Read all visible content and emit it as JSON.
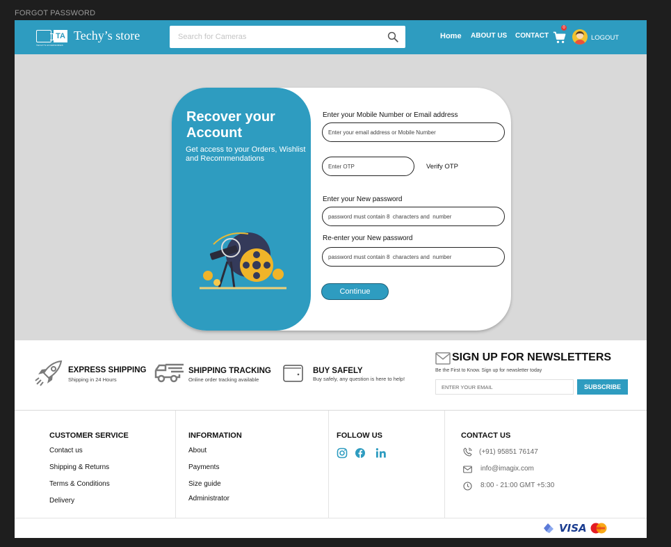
{
  "frame_label": "FORGOT PASSWORD",
  "header": {
    "store_name": "Techy’s store",
    "logo_text": "TA",
    "logo_sub": "TECHY'S ACCESSORIES",
    "search_placeholder": "Search for Cameras",
    "nav": [
      "Home",
      "ABOUT US",
      "CONTACT"
    ],
    "cart_count": "0",
    "logout": "LOGOUT"
  },
  "recover": {
    "title": "Recover your Account",
    "subtitle": "Get access to your Orders, Wishlist and Recommendations",
    "mobile_label": "Enter your Mobile Number  or Email address",
    "mobile_placeholder": "Enter your email address or Mobile Number",
    "otp_placeholder": "Enter OTP",
    "verify_otp": "Verify OTP",
    "new_password_label": "Enter your New password",
    "new_password_placeholder": "password must contain 8  characters and  number",
    "reenter_label": "Re-enter your New password",
    "reenter_placeholder": "password must contain 8  characters and  number",
    "continue": "Continue"
  },
  "features": [
    {
      "title": "EXPRESS SHIPPING",
      "sub": "Shipping in 24 Hours",
      "icon": "rocket-icon"
    },
    {
      "title": "SHIPPING TRACKING",
      "sub": "Online order tracking available",
      "icon": "truck-icon"
    },
    {
      "title": "BUY SAFELY",
      "sub": "Buy safely, any question is here to help!",
      "icon": "wallet-icon"
    }
  ],
  "newsletter": {
    "title": "SIGN UP FOR NEWSLETTERS",
    "sub": "Be the First to Know. Sign up for newsletter today",
    "placeholder": "ENTER YOUR EMAIL",
    "button": "SUBSCRIBE"
  },
  "footer": {
    "customer_service": {
      "title": "CUSTOMER SERVICE",
      "links": [
        "Contact us",
        "Shipping & Returns",
        "Terms & Conditions",
        "Delivery"
      ]
    },
    "information": {
      "title": "INFORMATION",
      "links": [
        "About",
        "Payments",
        "Size guide",
        "Administrator"
      ]
    },
    "follow": {
      "title": "FOLLOW US",
      "icons": [
        "instagram-icon",
        "facebook-icon",
        "linkedin-icon"
      ]
    },
    "contact": {
      "title": "CONTACT US",
      "phone": "(+91) 95851 76147",
      "email": "info@imagix.com",
      "hours": "8:00 - 21:00 GMT +5:30"
    },
    "payments": [
      "gpay-icon",
      "VISA",
      "mastercard-icon"
    ]
  },
  "colors": {
    "accent": "#2e9cc0",
    "page_bg": "#d9d9d9"
  }
}
